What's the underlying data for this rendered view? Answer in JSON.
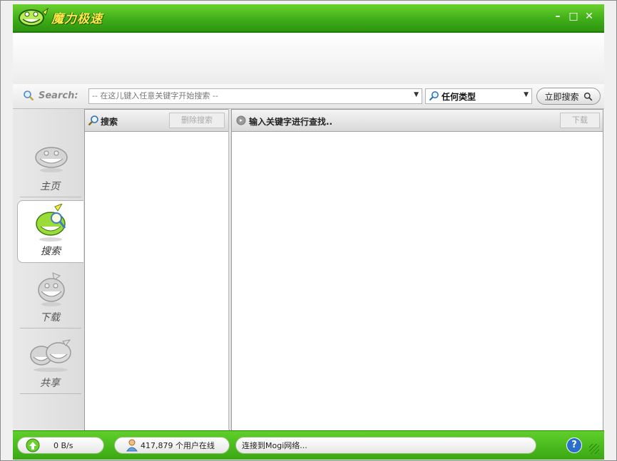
{
  "app": {
    "title": "魔力极速"
  },
  "window_controls": {
    "minimize": "–",
    "maximize": "□",
    "close": "✕"
  },
  "search": {
    "label": "Search:",
    "placeholder": "-- 在这儿键入任意关键字开始搜索 --",
    "type_value": "任何类型",
    "go_label": "立即搜索"
  },
  "nav": {
    "items": [
      {
        "label": "主页",
        "icon": "home-mascot-icon"
      },
      {
        "label": "搜索",
        "icon": "search-mascot-icon"
      },
      {
        "label": "下载",
        "icon": "download-mascot-icon"
      },
      {
        "label": "共享",
        "icon": "share-mascot-icon"
      }
    ],
    "active": "搜索"
  },
  "list_panel": {
    "title": "搜索",
    "delete_label": "删除搜索"
  },
  "results_panel": {
    "title": "输入关键字进行查找..",
    "download_label": "下载"
  },
  "status": {
    "speed": "0 B/s",
    "users": "417,879 个用户在线",
    "connection": "连接到Mogi网络...",
    "help": "?"
  },
  "colors": {
    "brand_green": "#3fae18",
    "accent_yellow": "#ffe74a",
    "link_blue": "#2a6fc9"
  }
}
